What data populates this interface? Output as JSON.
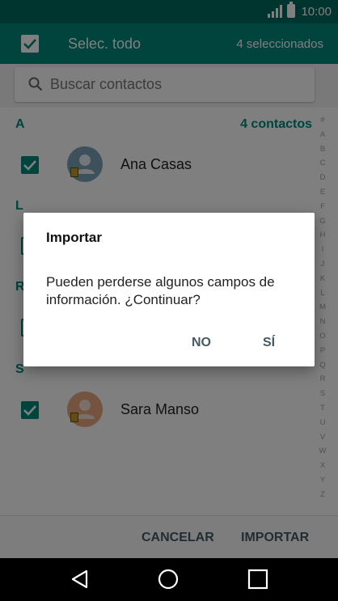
{
  "status_bar": {
    "time": "10:00",
    "signal_icon": "signal-icon",
    "battery_icon": "battery-icon"
  },
  "app_bar": {
    "select_all_label": "Selec. todo",
    "selected_count": "4 seleccionados"
  },
  "search": {
    "placeholder": "Buscar contactos",
    "value": ""
  },
  "sections": [
    {
      "letter": "A",
      "count": "4 contactos"
    },
    {
      "letter": "L"
    },
    {
      "letter": "R"
    },
    {
      "letter": "S"
    }
  ],
  "contacts": [
    {
      "name": "Ana Casas",
      "checked": true,
      "avatar_color": "#7aa3b8"
    },
    {
      "name": "Sara Manso",
      "checked": true,
      "avatar_color": "#e8a882"
    }
  ],
  "index_letters": [
    "#",
    "A",
    "B",
    "C",
    "D",
    "E",
    "F",
    "G",
    "H",
    "I",
    "J",
    "K",
    "L",
    "M",
    "N",
    "O",
    "P",
    "Q",
    "R",
    "S",
    "T",
    "U",
    "V",
    "W",
    "X",
    "Y",
    "Z"
  ],
  "bottom_bar": {
    "cancel_label": "CANCELAR",
    "import_label": "IMPORTAR"
  },
  "dialog": {
    "title": "Importar",
    "message": "Pueden perderse algunos campos de información. ¿Continuar?",
    "no_label": "NO",
    "yes_label": "SÍ"
  },
  "colors": {
    "accent": "#00897b",
    "status_bar": "#00695c",
    "button_text": "#455a64"
  }
}
